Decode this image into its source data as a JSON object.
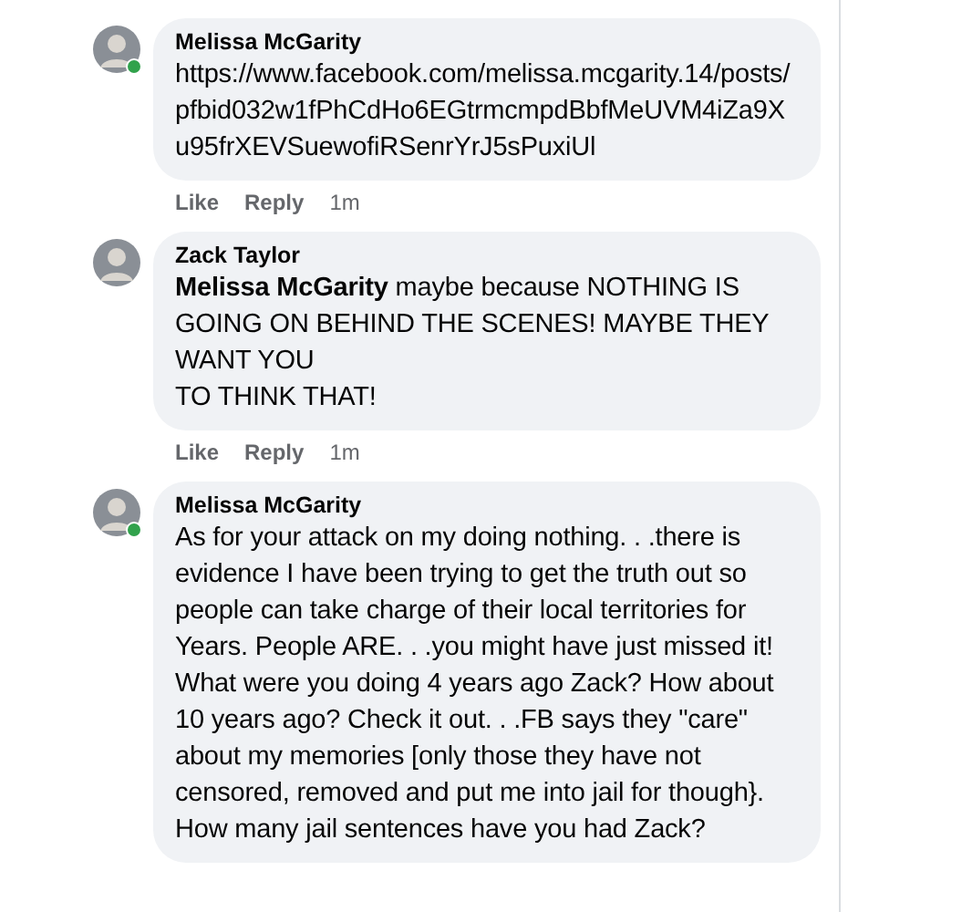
{
  "comments": [
    {
      "author": "Melissa McGarity",
      "online": true,
      "kind": "link",
      "text": "https://www.facebook.com/melissa.mcgarity.14/posts/pfbid032w1fPhCdHo6EGtrmcmpdBbfMeUVM4iZa9Xu95frXEVSuewofiRSenrYrJ5sPuxiUl",
      "actions": [
        "Like",
        "Reply"
      ],
      "time": "1m"
    },
    {
      "author": "Zack Taylor",
      "online": false,
      "kind": "text",
      "text": "**Melissa McGarity** maybe because NOTHING IS GOING ON BEHIND THE SCENES! MAYBE THEY WANT YOU\nTO THINK THAT!",
      "actions": [
        "Like",
        "Reply"
      ],
      "time": "1m"
    },
    {
      "author": "Melissa McGarity",
      "online": true,
      "kind": "text",
      "text": "As for your attack on my doing nothing. . .there is evidence I have been trying to get the truth out so people can take charge of their local territories for Years. People ARE. . .you might have just missed it! What were you doing 4 years ago Zack? How about 10 years ago? Check it out. . .FB says they \"care\" about my memories [only those they have not censored, removed and put me into jail for though}. How many jail sentences have you had Zack?"
    }
  ]
}
